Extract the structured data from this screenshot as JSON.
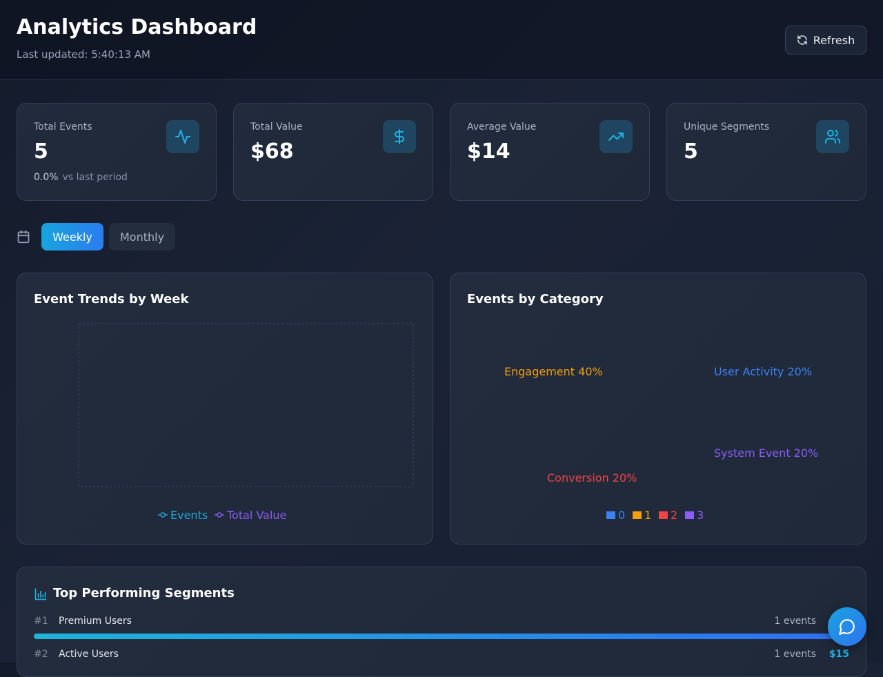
{
  "header": {
    "title": "Analytics Dashboard",
    "last_updated": "Last updated: 5:40:13 AM",
    "refresh_label": "Refresh"
  },
  "stats": [
    {
      "label": "Total Events",
      "value": "5",
      "change": "0.0%",
      "change_note": "vs last period",
      "icon": "activity-icon"
    },
    {
      "label": "Total Value",
      "value": "$68",
      "icon": "dollar-icon"
    },
    {
      "label": "Average Value",
      "value": "$14",
      "icon": "trending-up-icon"
    },
    {
      "label": "Unique Segments",
      "value": "5",
      "icon": "users-icon"
    }
  ],
  "period_toggle": {
    "options": [
      "Weekly",
      "Monthly"
    ],
    "selected": "Weekly"
  },
  "trend_panel": {
    "title": "Event Trends by Week",
    "legend": [
      {
        "label": "Events",
        "color": "#1ea7d9"
      },
      {
        "label": "Total Value",
        "color": "#8b5cf6"
      }
    ]
  },
  "category_panel": {
    "title": "Events by Category",
    "slice_labels": [
      {
        "label": "Engagement 40%",
        "color": "#f59e0b"
      },
      {
        "label": "User Activity 20%",
        "color": "#3b82f6"
      },
      {
        "label": "System Event 20%",
        "color": "#8b5cf6"
      },
      {
        "label": "Conversion 20%",
        "color": "#ef4444"
      }
    ],
    "legend": [
      {
        "label": "0",
        "color": "#3b82f6"
      },
      {
        "label": "1",
        "color": "#f59e0b"
      },
      {
        "label": "2",
        "color": "#ef4444"
      },
      {
        "label": "3",
        "color": "#8b5cf6"
      }
    ]
  },
  "chart_data": [
    {
      "type": "line",
      "title": "Event Trends by Week",
      "x": [],
      "series": [
        {
          "name": "Events",
          "values": []
        },
        {
          "name": "Total Value",
          "values": []
        }
      ],
      "grid": true,
      "legend_placement": "bottom"
    },
    {
      "type": "pie",
      "title": "Events by Category",
      "categories": [
        "Engagement",
        "User Activity",
        "System Event",
        "Conversion"
      ],
      "values": [
        40,
        20,
        20,
        20
      ],
      "legend_placement": "bottom"
    }
  ],
  "segments": {
    "title": "Top Performing Segments",
    "items": [
      {
        "rank": "#1",
        "name": "Premium Users",
        "events": "1 events",
        "bar_fraction": 1.0
      },
      {
        "rank": "#2",
        "name": "Active Users",
        "events": "1 events",
        "value": "$15"
      }
    ]
  }
}
